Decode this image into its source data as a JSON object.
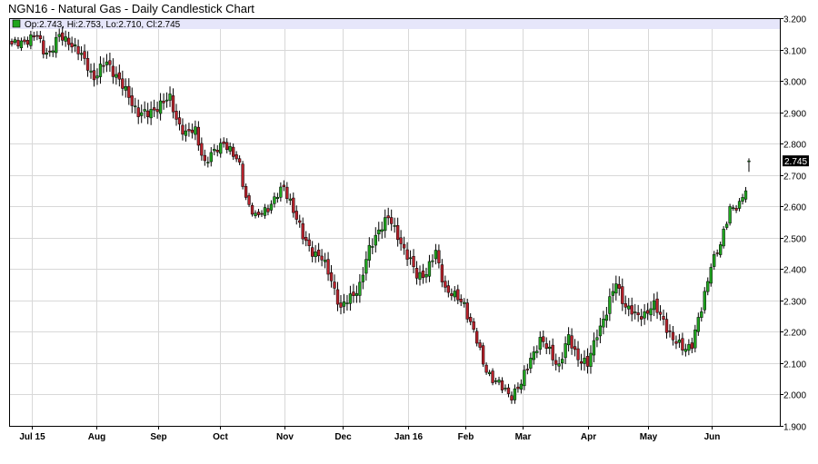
{
  "title": "NGN16 - Natural Gas - Daily Candlestick Chart",
  "ohlc_label": "Op:2.743, Hi:2.753, Lo:2.710, Cl:2.745",
  "last_price_label": "2.745",
  "colors": {
    "up": "#1fa51f",
    "down": "#b8212b",
    "grid": "#d8d8d8",
    "info_band": "#e6e6fa",
    "swatch": "#1fa51f",
    "last_price_bg": "#000000",
    "last_price_text": "#ffffff"
  },
  "chart_data": {
    "type": "candlestick",
    "title": "NGN16 - Natural Gas - Daily Candlestick Chart",
    "ylim": [
      1.9,
      3.2
    ],
    "y_ticks": [
      "1.900",
      "2.000",
      "2.100",
      "2.200",
      "2.300",
      "2.400",
      "2.500",
      "2.600",
      "2.700",
      "2.800",
      "2.900",
      "3.000",
      "3.100",
      "3.200"
    ],
    "x_ticks": [
      "Jul 15",
      "Aug",
      "Sep",
      "Oct",
      "Nov",
      "Dec",
      "Jan 16",
      "Feb",
      "Mar",
      "Apr",
      "May",
      "Jun"
    ],
    "grid": true,
    "last": {
      "open": 2.743,
      "high": 2.753,
      "low": 2.71,
      "close": 2.745
    },
    "path_anchors": [
      [
        0,
        3.11
      ],
      [
        4,
        3.13
      ],
      [
        8,
        3.14
      ],
      [
        10,
        3.1
      ],
      [
        12,
        3.09
      ],
      [
        15,
        3.14
      ],
      [
        18,
        3.13
      ],
      [
        24,
        3.05
      ],
      [
        26,
        3.01
      ],
      [
        30,
        3.06
      ],
      [
        33,
        3.02
      ],
      [
        35,
        2.98
      ],
      [
        40,
        2.9
      ],
      [
        43,
        2.89
      ],
      [
        47,
        2.93
      ],
      [
        50,
        2.94
      ],
      [
        52,
        2.88
      ],
      [
        55,
        2.83
      ],
      [
        58,
        2.84
      ],
      [
        61,
        2.74
      ],
      [
        64,
        2.77
      ],
      [
        67,
        2.81
      ],
      [
        70,
        2.76
      ],
      [
        72,
        2.73
      ],
      [
        74,
        2.63
      ],
      [
        77,
        2.56
      ],
      [
        80,
        2.59
      ],
      [
        83,
        2.62
      ],
      [
        86,
        2.66
      ],
      [
        88,
        2.62
      ],
      [
        90,
        2.56
      ],
      [
        92,
        2.5
      ],
      [
        95,
        2.46
      ],
      [
        98,
        2.43
      ],
      [
        101,
        2.37
      ],
      [
        104,
        2.27
      ],
      [
        107,
        2.31
      ],
      [
        110,
        2.35
      ],
      [
        113,
        2.46
      ],
      [
        116,
        2.53
      ],
      [
        119,
        2.56
      ],
      [
        122,
        2.51
      ],
      [
        125,
        2.44
      ],
      [
        128,
        2.38
      ],
      [
        131,
        2.39
      ],
      [
        134,
        2.45
      ],
      [
        137,
        2.34
      ],
      [
        140,
        2.31
      ],
      [
        143,
        2.29
      ],
      [
        146,
        2.2
      ],
      [
        149,
        2.1
      ],
      [
        152,
        2.05
      ],
      [
        155,
        2.02
      ],
      [
        158,
        2.0
      ],
      [
        161,
        2.03
      ],
      [
        164,
        2.12
      ],
      [
        167,
        2.17
      ],
      [
        170,
        2.14
      ],
      [
        173,
        2.09
      ],
      [
        176,
        2.18
      ],
      [
        179,
        2.12
      ],
      [
        182,
        2.09
      ],
      [
        185,
        2.2
      ],
      [
        188,
        2.26
      ],
      [
        191,
        2.36
      ],
      [
        194,
        2.28
      ],
      [
        197,
        2.25
      ],
      [
        200,
        2.26
      ],
      [
        203,
        2.28
      ],
      [
        206,
        2.24
      ],
      [
        209,
        2.17
      ],
      [
        212,
        2.15
      ],
      [
        215,
        2.16
      ],
      [
        218,
        2.27
      ],
      [
        221,
        2.42
      ],
      [
        224,
        2.47
      ],
      [
        227,
        2.6
      ],
      [
        230,
        2.6
      ],
      [
        232,
        2.65
      ],
      [
        233,
        2.745
      ]
    ]
  }
}
